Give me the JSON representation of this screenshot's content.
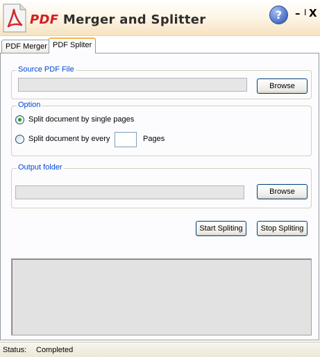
{
  "title_bar": {
    "title_pdf": "PDF",
    "title_rest": " Merger and Splitter",
    "help_symbol": "?",
    "minimize_symbol": "–",
    "separator_symbol": "I",
    "close_symbol": "X",
    "logo_icon": "pdf-file-icon",
    "colors": {
      "pdf_red": "#d21f1f",
      "help_blue": "#5b7fd2"
    }
  },
  "tabs": [
    {
      "label": "PDF Merger",
      "active": false
    },
    {
      "label": "PDF Spliter",
      "active": true
    }
  ],
  "source": {
    "legend": "Source PDF File",
    "path_value": "",
    "browse_label": "Browse"
  },
  "option": {
    "legend": "Option",
    "single_pages_label": "Split document by single pages",
    "every_label": "Split document by every",
    "pages_value": "",
    "pages_suffix": "Pages",
    "selected": "single_pages"
  },
  "output": {
    "legend": "Output folder",
    "path_value": "",
    "browse_label": "Browse"
  },
  "actions": {
    "start_label": "Start Spliting",
    "stop_label": "Stop Spliting"
  },
  "status": {
    "label": "Status:",
    "value": "Completed"
  }
}
